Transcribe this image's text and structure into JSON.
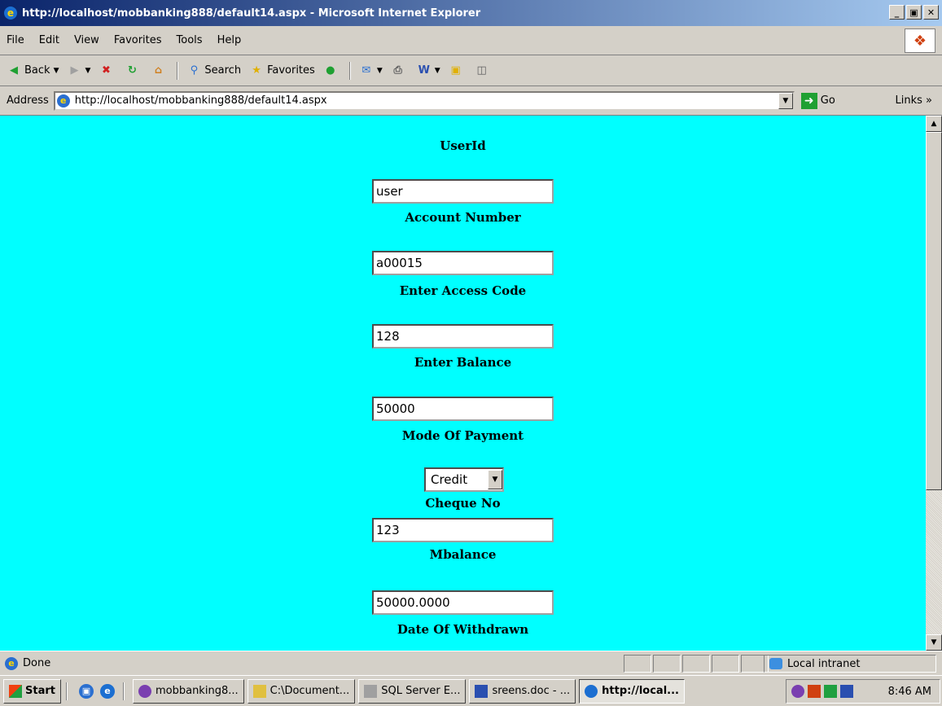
{
  "window": {
    "title": "http://localhost/mobbanking888/default14.aspx - Microsoft Internet Explorer"
  },
  "menu": {
    "items": [
      "File",
      "Edit",
      "View",
      "Favorites",
      "Tools",
      "Help"
    ]
  },
  "toolbar": {
    "back_label": "Back",
    "search_label": "Search",
    "favorites_label": "Favorites"
  },
  "address": {
    "label": "Address",
    "url": "http://localhost/mobbanking888/default14.aspx",
    "go_label": "Go",
    "links_label": "Links"
  },
  "form": {
    "userid_label": "UserId",
    "userid_value": "user",
    "account_label": "Account Number",
    "account_value": "a00015",
    "access_label": "Enter Access Code",
    "access_value": "128",
    "balance_label": "Enter Balance",
    "balance_value": "50000",
    "mode_label": "Mode Of Payment",
    "mode_value": "Credit",
    "cheque_label": "Cheque No",
    "cheque_value": "123",
    "mbalance_label": "Mbalance",
    "mbalance_value": "50000.0000",
    "date_label": "Date Of Withdrawn"
  },
  "status": {
    "text": "Done",
    "zone": "Local intranet"
  },
  "taskbar": {
    "start_label": "Start",
    "buttons": [
      "mobbanking8...",
      "C:\\Document...",
      "SQL Server E...",
      "sreens.doc - ...",
      "http://local..."
    ],
    "clock": "8:46 AM"
  },
  "colors": {
    "page_background": "#00ffff",
    "titlebar_start": "#0a246a"
  }
}
